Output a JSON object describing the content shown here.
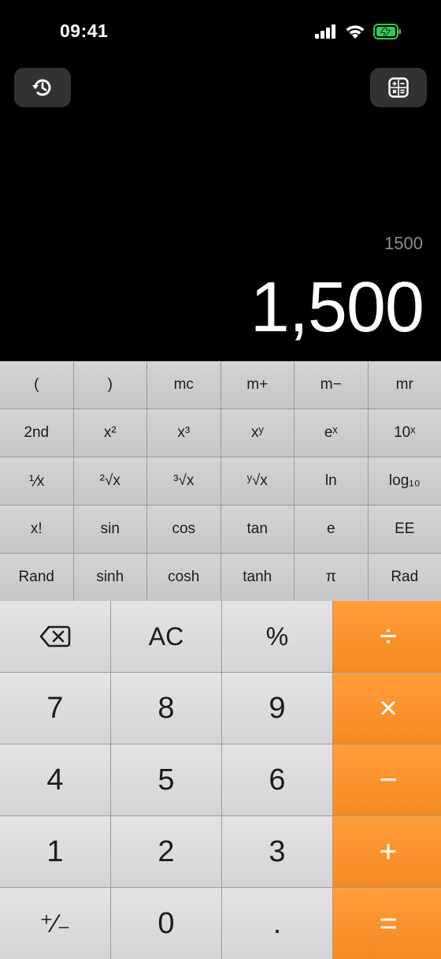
{
  "status": {
    "time": "09:41"
  },
  "top": {
    "history_icon": "history-icon",
    "mode_icon": "calculator-mode-icon"
  },
  "display": {
    "expression": "1500",
    "result": "1,500"
  },
  "scientific": [
    [
      "(",
      ")",
      "mc",
      "m+",
      "m−",
      "mr"
    ],
    [
      "2nd",
      "x²",
      "x³",
      "xʸ",
      "eˣ",
      "10ˣ"
    ],
    [
      "⅟x",
      "²√x",
      "³√x",
      "ʸ√x",
      "ln",
      "log₁₀"
    ],
    [
      "x!",
      "sin",
      "cos",
      "tan",
      "e",
      "EE"
    ],
    [
      "Rand",
      "sinh",
      "cosh",
      "tanh",
      "π",
      "Rad"
    ]
  ],
  "keypad": {
    "ac": "AC",
    "percent": "%",
    "divide": "÷",
    "seven": "7",
    "eight": "8",
    "nine": "9",
    "multiply": "×",
    "four": "4",
    "five": "5",
    "six": "6",
    "minus": "−",
    "one": "1",
    "two": "2",
    "three": "3",
    "plus": "+",
    "sign": "⁺⁄₋",
    "zero": "0",
    "decimal": ".",
    "equals": "="
  },
  "colors": {
    "operator": "#f8921f",
    "function_key": "#d0d0d2",
    "digit_key": "#dedee0",
    "background": "#000000"
  }
}
